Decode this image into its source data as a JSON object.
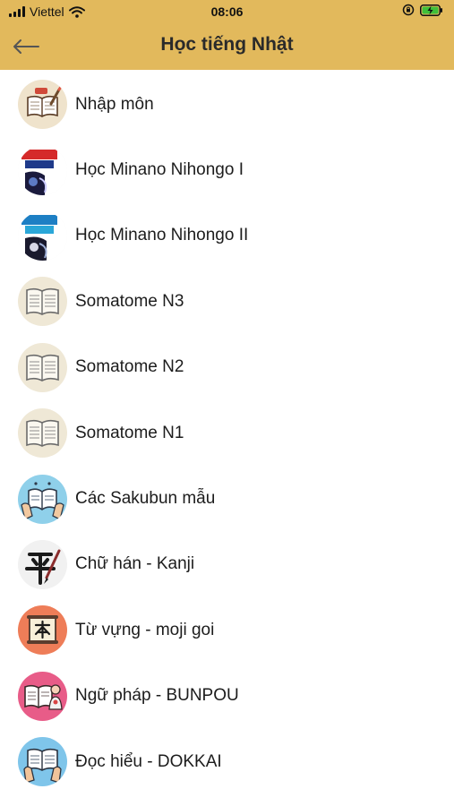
{
  "status_bar": {
    "carrier": "Viettel",
    "time": "08:06",
    "icons": [
      "signal-bars-icon",
      "wifi-icon",
      "orientation-lock-icon",
      "battery-charging-icon"
    ]
  },
  "header": {
    "title": "Học tiếng Nhật",
    "back_icon": "arrow-left-icon",
    "background": "#E2B95C"
  },
  "menu": {
    "items": [
      {
        "label": "Nhập môn",
        "icon": "notebook-pencil-icon"
      },
      {
        "label": "Học Minano Nihongo I",
        "icon": "minna-book-cover-1-icon"
      },
      {
        "label": "Học Minano Nihongo II",
        "icon": "minna-book-cover-2-icon"
      },
      {
        "label": "Somatome N3",
        "icon": "open-book-icon"
      },
      {
        "label": "Somatome N2",
        "icon": "open-book-icon"
      },
      {
        "label": "Somatome N1",
        "icon": "open-book-icon"
      },
      {
        "label": "Các Sakubun mẫu",
        "icon": "hands-holding-book-icon"
      },
      {
        "label": "Chữ hán - Kanji",
        "icon": "kanji-brush-icon"
      },
      {
        "label": "Từ vựng - moji goi",
        "icon": "scroll-kanji-icon"
      },
      {
        "label": "Ngữ pháp - BUNPOU",
        "icon": "book-with-character-icon"
      },
      {
        "label": "Đọc hiểu - DOKKAI",
        "icon": "reading-book-icon"
      }
    ]
  }
}
